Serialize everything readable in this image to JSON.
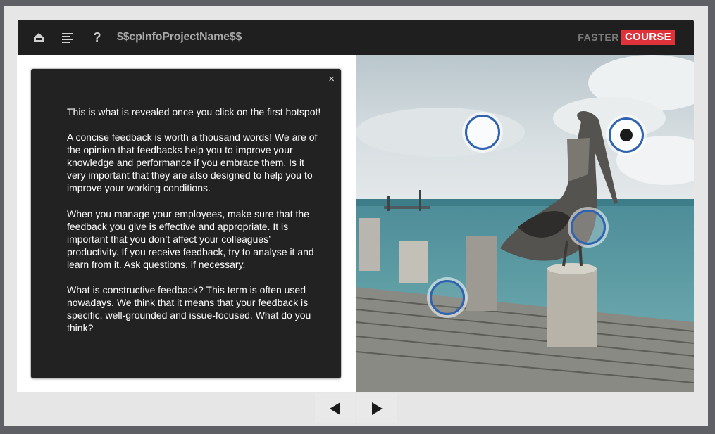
{
  "topbar": {
    "project_name": "$$cpInfoProjectName$$",
    "icons": [
      "home-icon",
      "menu-icon",
      "help-icon"
    ],
    "help_glyph": "?"
  },
  "brand": {
    "part1": "FASTER",
    "part2": "COURSE",
    "accent_color": "#e0323b"
  },
  "feedback_panel": {
    "close_glyph": "×",
    "paragraphs": [
      "This is what is revealed once you click on the first hotspot!",
      "A concise feedback is worth a thousand words! We are of the opinion that feedbacks help you to improve your knowledge and performance if you embrace them. Is it very important that they are also designed to help you to improve your working conditions.",
      "When you manage your employees, make sure that the feedback you give is effective and appropriate. It is important that you don’t affect your colleagues’ productivity. If you receive feedback, try to analyse it and learn from it. Ask questions, if necessary.",
      "What is constructive feedback? This term is often used nowadays. We think that it means that your feedback is specific, well-grounded and issue-focused. What do you think?"
    ]
  },
  "hotspots": [
    {
      "name": "hotspot-1",
      "state": "unvisited"
    },
    {
      "name": "hotspot-2",
      "state": "selected"
    },
    {
      "name": "hotspot-3",
      "state": "unvisited"
    },
    {
      "name": "hotspot-4",
      "state": "unvisited"
    }
  ],
  "navigation": {
    "prev_icon": "triangle-left-icon",
    "next_icon": "triangle-right-icon"
  },
  "colors": {
    "hotspot_ring": "#2f63b0",
    "panel_bg": "#222222",
    "topbar_bg": "#1f1f1f"
  }
}
